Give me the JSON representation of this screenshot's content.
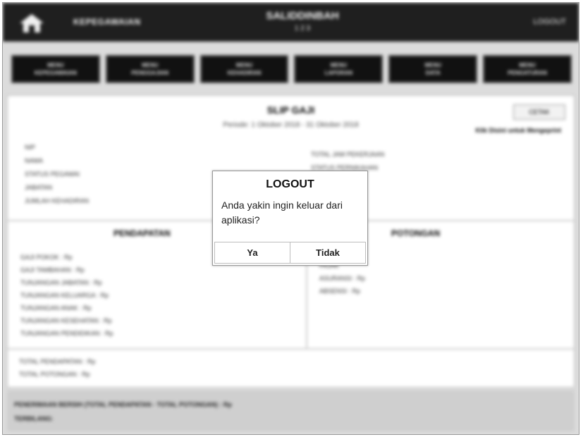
{
  "header": {
    "app_title": "KEPEGAWAIAN",
    "center_title": "SALIDDINBAH",
    "center_sub": "1 2 3",
    "logout_label": "LOGOUT"
  },
  "menu": {
    "items": [
      {
        "line1": "MENU",
        "line2": "KEPEGAWAIAN"
      },
      {
        "line1": "MENU",
        "line2": "PENGGAJIAN"
      },
      {
        "line1": "MENU",
        "line2": "KEHADIRAN"
      },
      {
        "line1": "MENU",
        "line2": "LAPORAN"
      },
      {
        "line1": "MENU",
        "line2": "DATA"
      },
      {
        "line1": "MENU",
        "line2": "PENGATURAN"
      }
    ]
  },
  "slip": {
    "title": "SLIP GAJI",
    "period": "Periode: 1 Oktober 2018 - 31 Oktober 2018",
    "print_button": "CETAK",
    "print_hint": "Klik Disini untuk Mengeprint"
  },
  "info_left": [
    "NIP",
    "NAMA",
    "STATUS PEGAWAI",
    "JABATAN",
    "JUMLAH KEHADIRAN"
  ],
  "info_right": [
    "TOTAL JAM PEKERJAAN",
    "STATUS PERNIKAHAN",
    "",
    ""
  ],
  "income": {
    "title": "PENDAPATAN",
    "items": [
      "GAJI POKOK : Rp",
      "GAJI TAMBAHAN : Rp",
      "TUNJANGAN JABATAN : Rp",
      "TUNJANGAN KELUARGA : Rp",
      "TUNJANGAN ANAK : Rp",
      "TUNJANGAN KESEHATAN : Rp",
      "TUNJANGAN PENDIDIKAN : Rp"
    ]
  },
  "deduction": {
    "title": "POTONGAN",
    "items": [
      "PAJAK",
      "ASURANSI : Rp",
      "ABSENSI : Rp"
    ]
  },
  "totals": [
    "TOTAL PENDAPATAN : Rp",
    "TOTAL POTONGAN : Rp"
  ],
  "footer": {
    "line1": "PENERIMAAN BERSIH (TOTAL PENDAPATAN - TOTAL POTONGAN) : Rp",
    "line2": "TERBILANG:"
  },
  "dialog": {
    "title": "LOGOUT",
    "message": "Anda yakin ingin keluar dari aplikasi?",
    "yes_label": "Ya",
    "no_label": "Tidak"
  }
}
